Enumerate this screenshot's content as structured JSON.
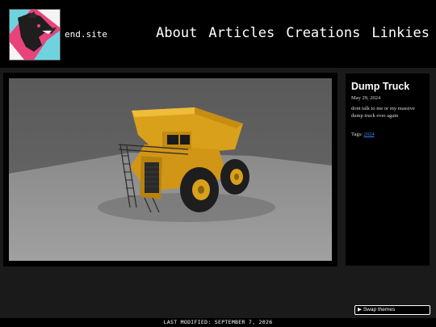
{
  "header": {
    "site_name": "end.site",
    "nav": [
      "About",
      "Articles",
      "Creations",
      "Linkies"
    ]
  },
  "post": {
    "title": "Dump Truck",
    "date": "May 29, 2024",
    "description": "dont talk to me or my massive dump truck ever again",
    "tags_label": "Tags:",
    "tags": [
      "2024"
    ]
  },
  "image": {
    "subject": "dump-truck-render"
  },
  "theme_button": {
    "label": "Swap themes",
    "icon": "triangle-right-icon"
  },
  "footer": {
    "text": "LAST MODIFIED: SEPTEMBER 7, 2026"
  },
  "colors": {
    "logo_pink": "#e8437b",
    "truck_yellow": "#e0a81c",
    "link_blue": "#3b82f6"
  }
}
